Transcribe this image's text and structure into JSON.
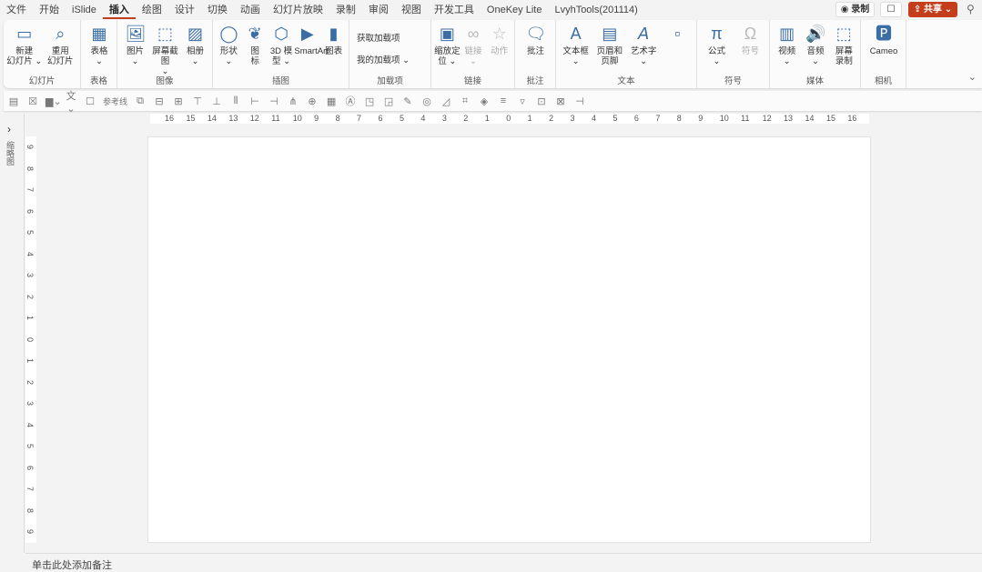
{
  "tabs": [
    "文件",
    "开始",
    "iSlide",
    "插入",
    "绘图",
    "设计",
    "切换",
    "动画",
    "幻灯片放映",
    "录制",
    "审阅",
    "视图",
    "开发工具",
    "OneKey Lite",
    "LvyhTools(201114)"
  ],
  "active_tab": "插入",
  "top_right": {
    "record": "◉ 录制",
    "comment": "☐",
    "share": "⇪ 共享 ⌄",
    "pin": "⚲"
  },
  "groups": [
    {
      "label": "幻灯片",
      "buttons": [
        {
          "label": "新建\n幻灯片 ⌄",
          "icon": "▭"
        },
        {
          "label": "重用\n幻灯片",
          "icon": "⌕"
        }
      ]
    },
    {
      "label": "表格",
      "buttons": [
        {
          "label": "表格\n⌄",
          "icon": "▦"
        }
      ]
    },
    {
      "label": "图像",
      "buttons": [
        {
          "label": "图片\n⌄",
          "icon": "🖼"
        },
        {
          "label": "屏幕截图\n⌄",
          "icon": "⬚"
        },
        {
          "label": "相册\n⌄",
          "icon": "▨"
        }
      ]
    },
    {
      "label": "插图",
      "buttons": [
        {
          "label": "形状\n⌄",
          "icon": "◯"
        },
        {
          "label": "图\n标",
          "icon": "❦"
        },
        {
          "label": "3D 模\n型 ⌄",
          "icon": "⬡"
        },
        {
          "label": "SmartArt",
          "icon": "▶"
        },
        {
          "label": "图表",
          "icon": "▮"
        }
      ]
    },
    {
      "label": "加载项",
      "small": [
        "获取加载项",
        "我的加载项 ⌄"
      ]
    },
    {
      "label": "链接",
      "buttons": [
        {
          "label": "缩放定\n位 ⌄",
          "icon": "▣"
        },
        {
          "label": "链接\n⌄",
          "icon": "∞",
          "disabled": true
        },
        {
          "label": "动作",
          "icon": "☆",
          "disabled": true
        }
      ]
    },
    {
      "label": "批注",
      "buttons": [
        {
          "label": "批注",
          "icon": "🗨"
        }
      ]
    },
    {
      "label": "文本",
      "buttons": [
        {
          "label": "文本框\n⌄",
          "icon": "A"
        },
        {
          "label": "页眉和页脚",
          "icon": "▤"
        },
        {
          "label": "艺术字\n⌄",
          "icon": "𝘈"
        },
        {
          "label": "",
          "icon": "▫"
        }
      ]
    },
    {
      "label": "符号",
      "buttons": [
        {
          "label": "公式\n⌄",
          "icon": "π"
        },
        {
          "label": "符号",
          "icon": "Ω",
          "disabled": true
        }
      ]
    },
    {
      "label": "媒体",
      "buttons": [
        {
          "label": "视频\n⌄",
          "icon": "▥"
        },
        {
          "label": "音频\n⌄",
          "icon": "🔊"
        },
        {
          "label": "屏幕\n录制",
          "icon": "⬚"
        }
      ]
    },
    {
      "label": "相机",
      "buttons": [
        {
          "label": "Cameo",
          "icon": "🅿"
        }
      ]
    }
  ],
  "qat": {
    "guides_label": "参考线",
    "icons": [
      "▤",
      "☒",
      "▆⌄",
      "文⌄",
      "☐"
    ]
  },
  "ruler_h": [
    "16",
    "15",
    "14",
    "13",
    "12",
    "11",
    "10",
    "9",
    "8",
    "7",
    "6",
    "5",
    "4",
    "3",
    "2",
    "1",
    "0",
    "1",
    "2",
    "3",
    "4",
    "5",
    "6",
    "7",
    "8",
    "9",
    "10",
    "11",
    "12",
    "13",
    "14",
    "15",
    "16"
  ],
  "ruler_v": [
    "9",
    "8",
    "7",
    "6",
    "5",
    "4",
    "3",
    "2",
    "1",
    "0",
    "1",
    "2",
    "3",
    "4",
    "5",
    "6",
    "7",
    "8",
    "9"
  ],
  "thumbnails_label": "缩略图",
  "expand": "›",
  "notes_placeholder": "单击此处添加备注"
}
